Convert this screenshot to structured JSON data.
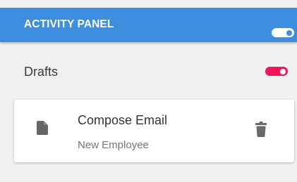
{
  "header": {
    "title": "ACTIVITY PANEL",
    "toggle_state": "on"
  },
  "drafts": {
    "title": "Drafts",
    "toggle_state": "on",
    "toggle_color": "#f0165a"
  },
  "draft_item": {
    "title": "Compose Email",
    "subtitle": "New Employee",
    "icon": "document-icon",
    "action_icon": "trash-icon"
  },
  "colors": {
    "header_bg": "#3d8ede",
    "panel_bg": "#f0f0f0",
    "accent_toggle": "#f0165a"
  }
}
